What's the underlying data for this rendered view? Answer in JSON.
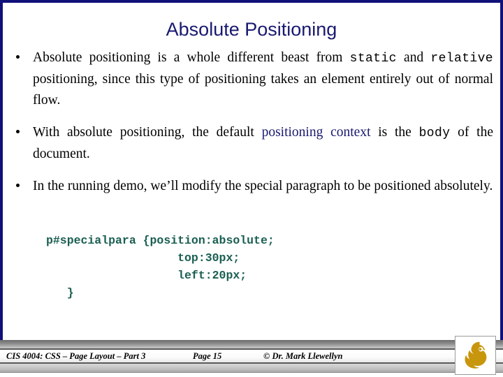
{
  "slide": {
    "title": "Absolute Positioning",
    "title_color": "#191970",
    "background_color": "#ffffff",
    "border_color": "#11117a",
    "code_color": "#1a5f52",
    "logo_color": "#C8960C"
  },
  "bullets": [
    {
      "marker": "bullet-dot",
      "segments": [
        {
          "text": "Absolute positioning is a whole different beast from ",
          "style": "serif"
        },
        {
          "text": "static",
          "style": "mono"
        },
        {
          "text": " and ",
          "style": "serif"
        },
        {
          "text": "relative",
          "style": "mono"
        },
        {
          "text": " positioning, since this type of positioning takes an element entirely out of normal flow.",
          "style": "serif"
        }
      ]
    },
    {
      "marker": "bullet-dot",
      "segments": [
        {
          "text": "With absolute positioning, the default ",
          "style": "serif"
        },
        {
          "text": "positioning context",
          "style": "serif-navy"
        },
        {
          "text": " is the ",
          "style": "serif"
        },
        {
          "text": "body",
          "style": "mono"
        },
        {
          "text": " of the document.",
          "style": "serif"
        }
      ]
    },
    {
      "marker": "bullet-dot",
      "segments": [
        {
          "text": "In the running demo, we’ll modify the special paragraph to be positioned absolutely.",
          "style": "serif"
        }
      ]
    }
  ],
  "code_block": {
    "lines": [
      "p#specialpara {position:absolute;",
      "                   top:30px;",
      "                   left:20px;",
      "   }"
    ],
    "text": "p#specialpara {position:absolute;\n                   top:30px;\n                   left:20px;\n   }"
  },
  "footer": {
    "course": "CIS 4004: CSS – Page Layout – Part 3",
    "page": "Page 15",
    "author": "© Dr. Mark Llewellyn",
    "logo_name": "ucf-pegasus-logo"
  }
}
